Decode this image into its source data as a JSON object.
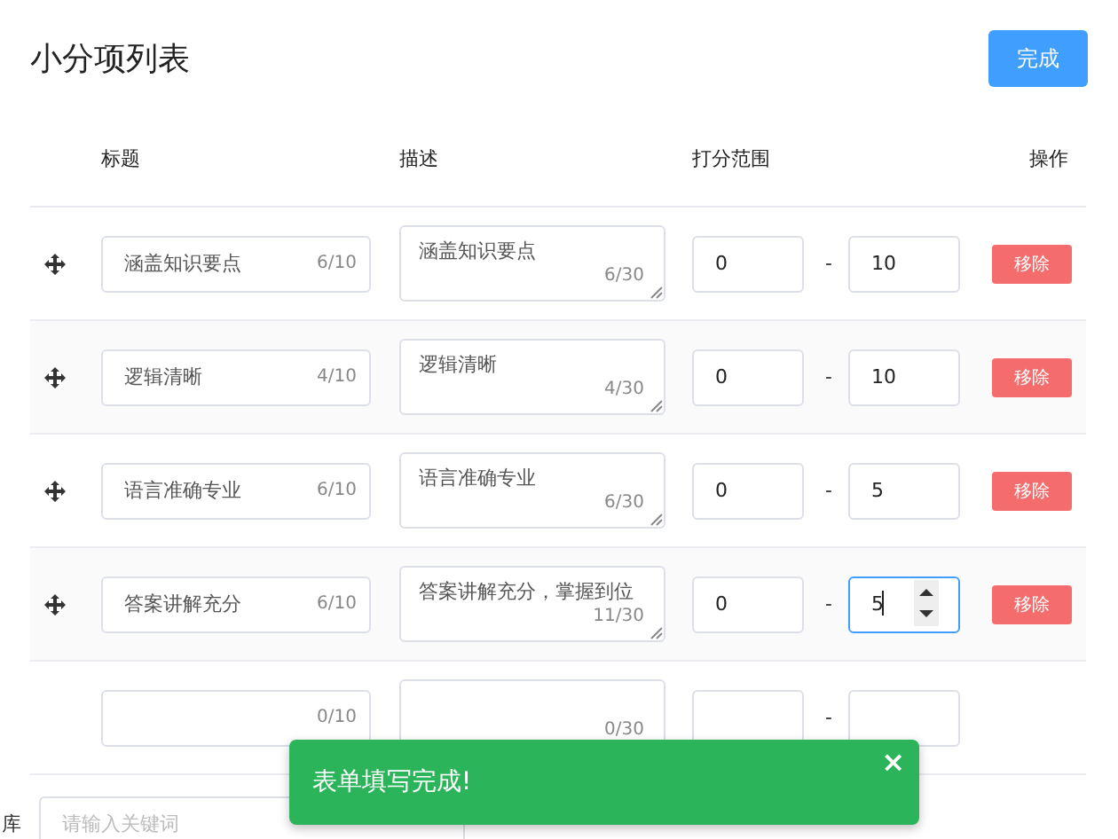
{
  "title": "小分项列表",
  "done_button": "完成",
  "columns": [
    "标题",
    "描述",
    "打分范围",
    "操作"
  ],
  "rows": [
    {
      "kind": "item",
      "title": "涵盖知识要点",
      "title_count": "6/10",
      "desc": "涵盖知识要点",
      "desc_count": "6/30",
      "min": "0",
      "separator": "-",
      "max": "10",
      "max_focused": false,
      "remove": "移除"
    },
    {
      "kind": "item",
      "title": "逻辑清晰",
      "title_count": "4/10",
      "desc": "逻辑清晰",
      "desc_count": "4/30",
      "min": "0",
      "separator": "-",
      "max": "10",
      "max_focused": false,
      "remove": "移除"
    },
    {
      "kind": "item",
      "title": "语言准确专业",
      "title_count": "6/10",
      "desc": "语言准确专业",
      "desc_count": "6/30",
      "min": "0",
      "separator": "-",
      "max": "5",
      "max_focused": false,
      "remove": "移除"
    },
    {
      "kind": "item",
      "title": "答案讲解充分",
      "title_count": "6/10",
      "desc": "答案讲解充分，掌握到位",
      "desc_count": "11/30",
      "min": "0",
      "separator": "-",
      "max": "5",
      "max_focused": true,
      "remove": "移除"
    },
    {
      "kind": "new",
      "title_count": "0/10",
      "desc_count": "0/30",
      "separator": "-",
      "max_focused": false
    }
  ],
  "bank": {
    "label": "库",
    "placeholder": "请输入关键词"
  },
  "toast": {
    "message": "表单填写完成!",
    "close": "×"
  }
}
